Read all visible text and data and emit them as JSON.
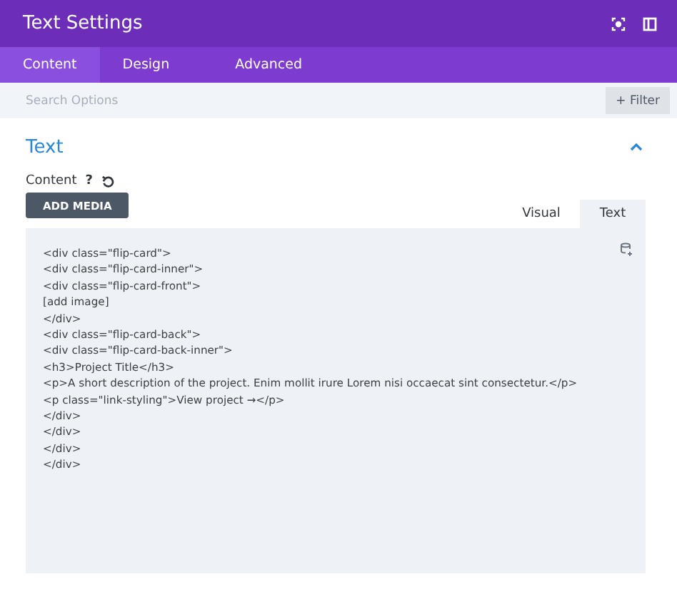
{
  "window": {
    "title": "Text Settings"
  },
  "tabs": [
    {
      "label": "Content",
      "selected": true
    },
    {
      "label": "Design",
      "selected": false
    },
    {
      "label": "Advanced",
      "selected": false
    }
  ],
  "search": {
    "placeholder": "Search Options",
    "filter_button": "+ Filter"
  },
  "section": {
    "title": "Text",
    "expanded": true
  },
  "field": {
    "label": "Content",
    "help": "?",
    "add_media": "ADD MEDIA"
  },
  "editor_tabs": [
    {
      "label": "Visual",
      "selected": false
    },
    {
      "label": "Text",
      "selected": true
    }
  ],
  "code_lines": [
    "<div class=\"flip-card\">",
    "<div class=\"flip-card-inner\">",
    "<div class=\"flip-card-front\">",
    "[add image]",
    "</div>",
    "<div class=\"flip-card-back\">",
    "<div class=\"flip-card-back-inner\">",
    "<h3>Project Title</h3>",
    "<p>A short description of the project. Enim mollit irure Lorem nisi occaecat sint consectetur.</p>",
    "<p class=\"link-styling\">View project →</p>",
    "</div>",
    "</div>",
    "</div>",
    "</div>"
  ]
}
